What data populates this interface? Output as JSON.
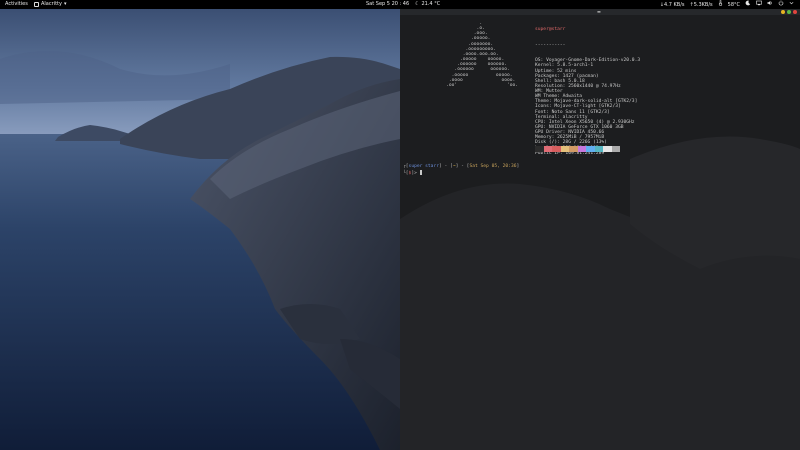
{
  "topbar": {
    "activities": "Activities",
    "app_name": "Alacritty",
    "app_dropdown": "▾",
    "clock": "Sat Sep 5  20 : 46",
    "weather_icon": "☾",
    "weather": "21.4 °C",
    "net_down": "↓4.7 KB/s",
    "net_up": "↑5.3KB/s",
    "temp": "58°C",
    "icons": [
      "night-mode-icon",
      "network-icon",
      "volume-icon",
      "power-icon",
      "chevron-down-icon"
    ]
  },
  "terminal": {
    "tab_icon": "▬",
    "logo_lines": [
      "                    .",
      "                   .o.",
      "                  .ooo.",
      "                 .ooooo.",
      "                .ooooooo.",
      "               .ooooooooo.",
      "              .oooo.ooo.oo.",
      "             .ooooo    ooooo.",
      "            .oooooo    oooooo.",
      "           .oooooo      oooooo.",
      "          .ooooo          ooooo.",
      "         .oooo              oooo.",
      "        .oo'                  'oo."
    ],
    "user_host": "super@starr",
    "separator": "-----------",
    "info_lines": [
      "OS: Voyager-Gnome-Dark-Edition-v20.0.3",
      "Kernel: 5.8.5-arch1-1",
      "Uptime: 52 mins",
      "Packages: 1427 (pacman)",
      "Shell: bash 5.0.18",
      "Resolution: 2560x1440 @ 74.97Hz",
      "WM: Mutter",
      "WM Theme: Adwaita",
      "Theme: Mojave-dark-solid-alt [GTK2/3]",
      "Icons: Mojave-CT-light [GTK2/3]",
      "Font: Noto Sans 11 [GTK2/3]",
      "Terminal: alacritty",
      "CPU: Intel Xeon X5650 (4) @ 2.930GHz",
      "GPU: NVIDIA GeForce GTX 1060 3GB",
      "GPU Driver: NVIDIA 450.66",
      "Memory: 2625MiB / 7957MiB",
      "Disk (/): 28G / 226G (13%)",
      "Local IP: 192.168.1.102",
      "Public IP: 109.81.241.289"
    ],
    "swatch_colors": [
      "#2b2b2b",
      "#e06c75",
      "#d75f5f",
      "#e5c07b",
      "#d19a66",
      "#c678dd",
      "#61afef",
      "#56b6c2",
      "#e6e6e6",
      "#aaaaaa"
    ],
    "prompt_open": "┌[",
    "prompt_user": "super starr",
    "prompt_mid": "] - [",
    "prompt_dir": "~",
    "prompt_mid2": "] - [",
    "prompt_date": "Sat Sep 05, 20:36",
    "prompt_close": "]",
    "prompt2_open": "└[",
    "prompt2_code": "$",
    "prompt2_close": "]>"
  }
}
